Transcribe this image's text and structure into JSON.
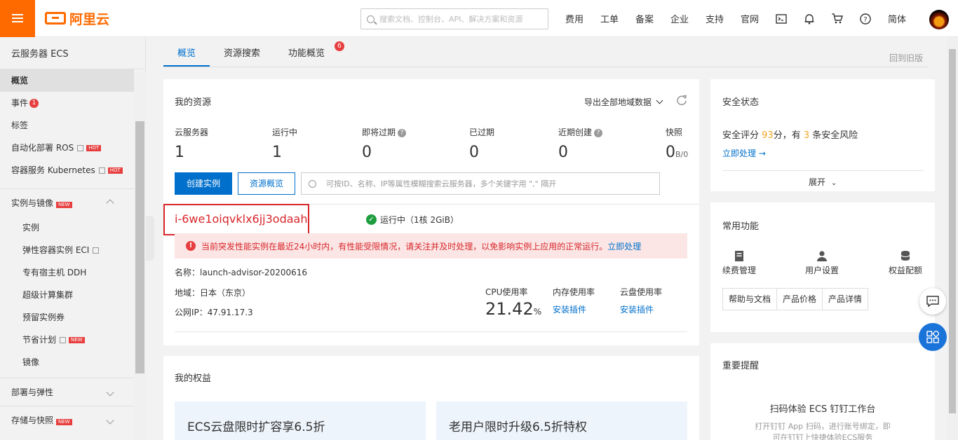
{
  "header": {
    "logo_text": "阿里云",
    "search_placeholder": "搜索文档、控制台、API、解决方案和资源",
    "nav": [
      "费用",
      "工单",
      "备案",
      "企业",
      "支持",
      "官网"
    ],
    "lang": "简体"
  },
  "sidebar": {
    "title": "云服务器 ECS",
    "items": [
      {
        "label": "概览"
      },
      {
        "label": "事件",
        "badge": "1"
      },
      {
        "label": "标签"
      },
      {
        "label": "自动化部署 ROS",
        "tag": "HOT"
      },
      {
        "label": "容器服务 Kubernetes",
        "tag": "HOT"
      }
    ],
    "group_instances": {
      "label": "实例与镜像",
      "tag": "NEW"
    },
    "sub_items": [
      {
        "label": "实例"
      },
      {
        "label": "弹性容器实例 ECI"
      },
      {
        "label": "专有宿主机 DDH"
      },
      {
        "label": "超级计算集群"
      },
      {
        "label": "预留实例券"
      },
      {
        "label": "节省计划",
        "tag": "NEW"
      },
      {
        "label": "镜像"
      }
    ],
    "group_deploy": {
      "label": "部署与弹性"
    },
    "group_storage": {
      "label": "存储与快照",
      "tag": "NEW"
    }
  },
  "tabs": [
    {
      "label": "概览"
    },
    {
      "label": "资源搜索"
    },
    {
      "label": "功能概览",
      "badge": "6"
    }
  ],
  "back_old": "回到旧版",
  "resources": {
    "title": "我的资源",
    "export": "导出全部地域数据",
    "stats": [
      {
        "label": "云服务器",
        "value": "1"
      },
      {
        "label": "运行中",
        "value": "1"
      },
      {
        "label": "即将过期",
        "value": "0"
      },
      {
        "label": "已过期",
        "value": "0"
      },
      {
        "label": "近期创建",
        "value": "0"
      },
      {
        "label": "快照",
        "value": "0",
        "unit": "B/0"
      }
    ],
    "create_btn": "创建实例",
    "overview_btn": "资源概览",
    "search_placeholder": "可按ID、名称、IP等属性模糊搜索云服务器，多个关键字用 \",\" 隔开"
  },
  "instance": {
    "id": "i-6we1oiqvklx6jj3odaah",
    "status": "运行中（1核 2GiB）",
    "alert_text": "当前突发性能实例在最近24小时内，有性能受限情况，请关注并及时处理，以免影响实例上应用的正常运行。",
    "alert_link": "立即处理",
    "name": "名称：launch-advisor-20200616",
    "region": "地域：日本（东京）",
    "ip": "公网IP：47.91.17.3",
    "cpu_label": "CPU使用率",
    "cpu_value": "21.42",
    "cpu_unit": "%",
    "mem_label": "内存使用率",
    "mem_link": "安装插件",
    "disk_label": "云盘使用率",
    "disk_link": "安装插件"
  },
  "benefits": {
    "title": "我的权益",
    "items": [
      "ECS云盘限时扩容享6.5折",
      "老用户限时升级6.5折特权"
    ]
  },
  "security": {
    "title": "安全状态",
    "score_prefix": "安全评分",
    "score": "93",
    "score_mid": "分，有",
    "risk": "3",
    "score_suffix": "条安全风险",
    "action": "立即处理 →",
    "expand": "展开"
  },
  "common": {
    "title": "常用功能",
    "icons": [
      "续费管理",
      "用户设置",
      "权益配额"
    ],
    "buttons": [
      "帮助与文档",
      "产品价格",
      "产品详情"
    ]
  },
  "reminder": {
    "title": "重要提醒",
    "heading": "扫码体验 ECS 钉钉工作台",
    "desc1": "打开钉钉 App 扫码，进行账号绑定，即",
    "desc2": "可在钉钉上快捷体验ECS服务"
  },
  "colors": {
    "brand": "#ff6a00",
    "link": "#0070cc",
    "danger": "#d8262a",
    "success": "#1e9e3e"
  }
}
